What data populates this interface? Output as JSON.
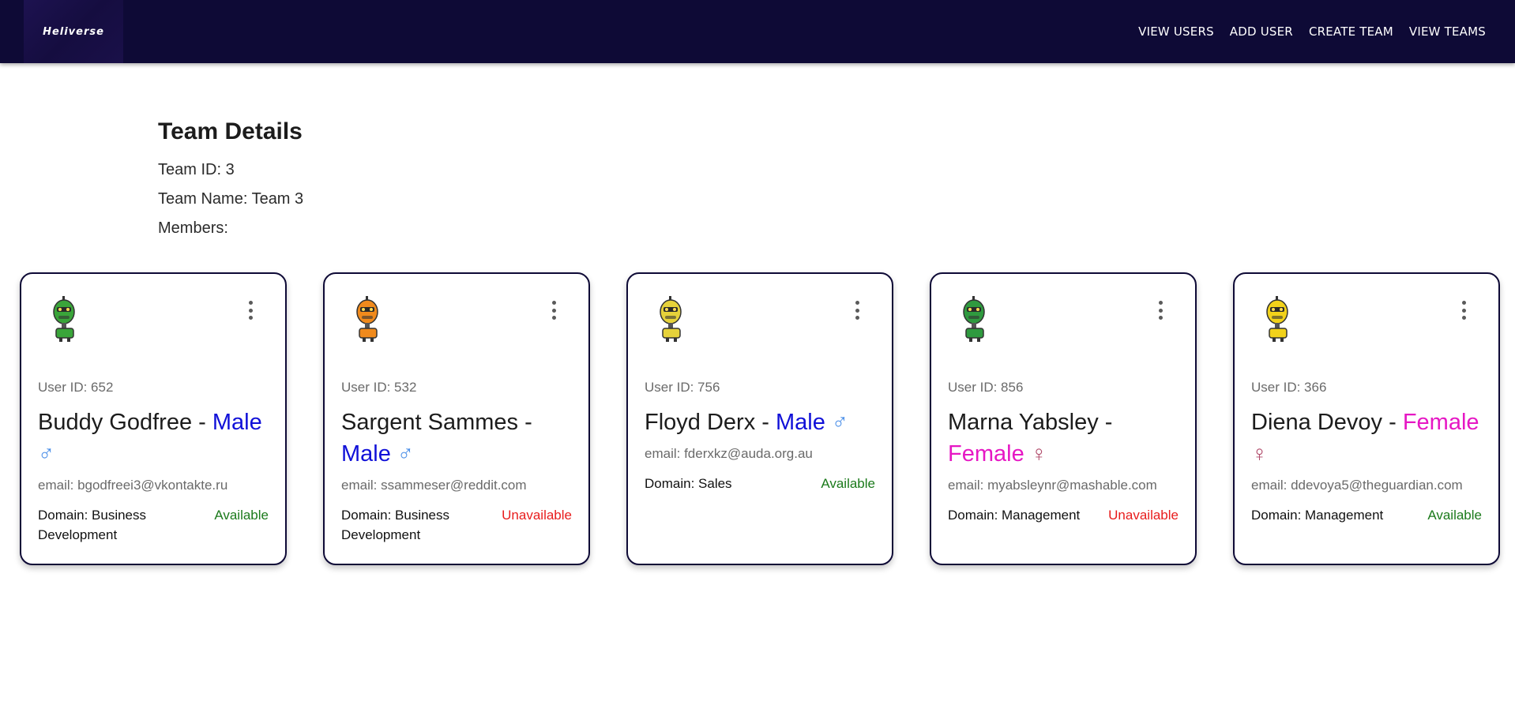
{
  "nav": {
    "logo_text": "Heliverse",
    "links": [
      "VIEW USERS",
      "ADD USER",
      "CREATE TEAM",
      "VIEW TEAMS"
    ]
  },
  "team": {
    "heading": "Team Details",
    "id_line": "Team ID: 3",
    "name_line": "Team Name: Team 3",
    "members_label": "Members:"
  },
  "members": [
    {
      "uid": "User ID: 652",
      "name": "Buddy Godfree -",
      "gender": "Male",
      "gender_symbol": "♂",
      "email": "email: bgodfreei3@vkontakte.ru",
      "domain": "Domain: Business Development",
      "status": "Available",
      "avatar_color": "#3aa53a"
    },
    {
      "uid": "User ID: 532",
      "name": "Sargent Sammes -",
      "gender": "Male",
      "gender_symbol": "♂",
      "email": "email: ssammeser@reddit.com",
      "domain": "Domain: Business Development",
      "status": "Unavailable",
      "avatar_color": "#f08a1c"
    },
    {
      "uid": "User ID: 756",
      "name": "Floyd Derx -",
      "gender": "Male",
      "gender_symbol": "♂",
      "email": "email: fderxkz@auda.org.au",
      "domain": "Domain: Sales",
      "status": "Available",
      "avatar_color": "#e6d23a"
    },
    {
      "uid": "User ID: 856",
      "name": "Marna Yabsley -",
      "gender": "Female",
      "gender_symbol": "♀",
      "email": "email: myabsleynr@mashable.com",
      "domain": "Domain: Management",
      "status": "Unavailable",
      "avatar_color": "#2f9a3f"
    },
    {
      "uid": "User ID: 366",
      "name": "Diena Devoy -",
      "gender": "Female",
      "gender_symbol": "♀",
      "email": "email: ddevoya5@theguardian.com",
      "domain": "Domain: Management",
      "status": "Available",
      "avatar_color": "#f2d21a"
    }
  ],
  "colors": {
    "nav_bg": "#0e0a36",
    "male": "#1010d8",
    "female": "#e617c4",
    "available": "#1b7a1b",
    "unavailable": "#e81c1c"
  }
}
